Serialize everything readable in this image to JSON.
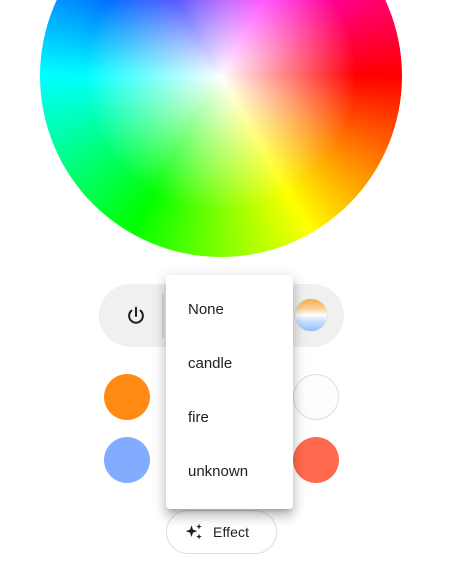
{
  "color_picker": {
    "wheel_name": "color-wheel"
  },
  "controls": {
    "power_icon": "power-icon",
    "temperature_icon": "color-temperature-icon"
  },
  "presets": [
    {
      "color": "#ff8a14"
    },
    {
      "color": "#fdfdfd"
    },
    {
      "color": "#82acff"
    },
    {
      "color": "#ff6a4e"
    }
  ],
  "effect_button": {
    "label": "Effect",
    "icon": "sparkle-icon"
  },
  "effect_menu": {
    "items": [
      {
        "label": "None"
      },
      {
        "label": "candle"
      },
      {
        "label": "fire"
      },
      {
        "label": "unknown"
      }
    ]
  }
}
